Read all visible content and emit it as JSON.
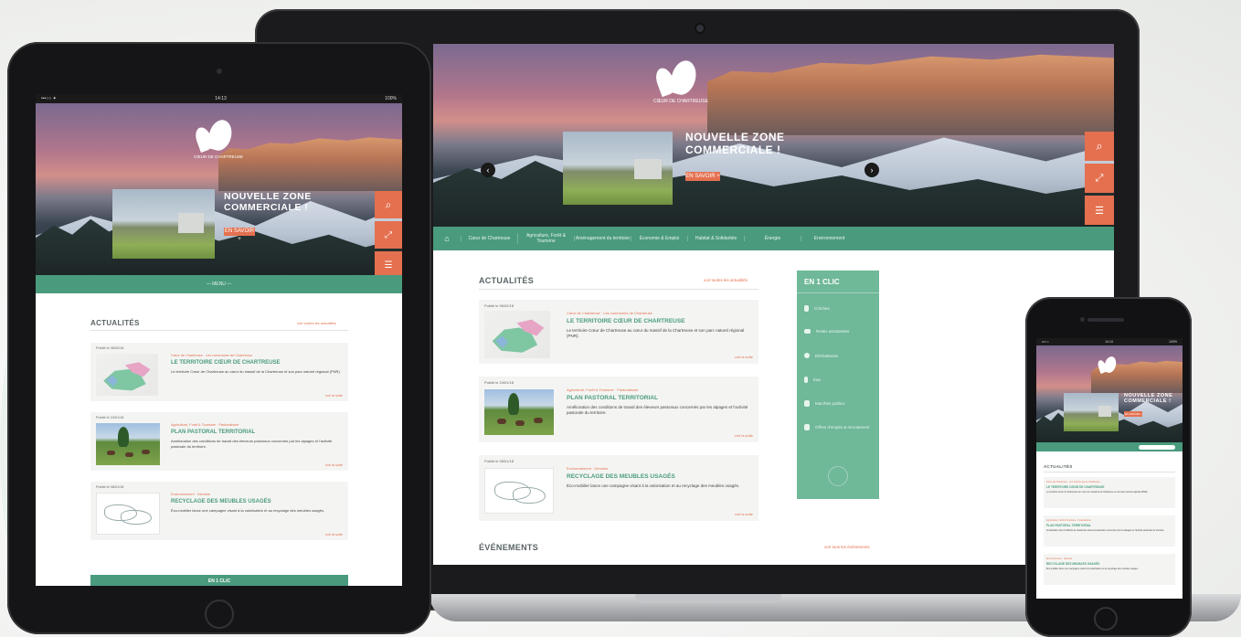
{
  "brand": {
    "logo_text": "CŒUR DE CHARTREUSE",
    "accent": "#4a9b7e",
    "orange": "#e4704f"
  },
  "hero": {
    "title": "NOUVELLE ZONE COMMERCIALE !",
    "button": "EN SAVOIR +"
  },
  "tools": [
    "search-icon",
    "expand-icon",
    "contact-icon"
  ],
  "nav": {
    "items": [
      "Cœur de Chartreuse",
      "Agriculture, Forêt & Tourisme",
      "Aménagement du territoire",
      "Économie & Emploi",
      "Habitat & Solidarités",
      "Énergie",
      "Environnement"
    ],
    "tablet_menu": "— MENU —"
  },
  "news": {
    "title": "ACTUALITÉS",
    "see_all": "voir toutes les actualités",
    "items": [
      {
        "date": "Publié le 06/02/18",
        "tag": "Cœur de Chartreuse · Les communes de Chartreuse",
        "title": "LE TERRITOIRE CŒUR DE CHARTREUSE",
        "text": "Le territoire Cœur de Chartreuse au cœur du massif de la Chartreuse et son parc naturel régional (PNR).",
        "more": "voir la suite"
      },
      {
        "date": "Publié le 24/01/18",
        "tag": "Agriculture, Forêt & Tourisme · Pastoralisme",
        "title": "PLAN PASTORAL TERRITORIAL",
        "text": "Amélioration des conditions de travail des éleveurs pastoraux concernés par les alpages et l'activité pastorale du territoire.",
        "more": "voir la suite"
      },
      {
        "date": "Publié le 08/01/18",
        "tag": "Environnement · Déchets",
        "title": "RECYCLAGE DES MEUBLES USAGÉS",
        "text": "Éco-mobilier lance une campagne visant à la valorisation et au recyclage des meubles usagés.",
        "more": "voir la suite"
      }
    ]
  },
  "events": {
    "title": "ÉVÉNEMENTS",
    "see_all": "voir tous les événements"
  },
  "cdc": {
    "title": "EN 1 CLIC",
    "items": [
      "Crèches",
      "Relais assistantes",
      "Déchetteries",
      "Eau",
      "Marchés publics",
      "Offres d'emploi & recrutement"
    ]
  },
  "status": {
    "left": "•••○○ ✦",
    "time": "14:13",
    "right": "100%"
  },
  "phone_status": {
    "left": "•••○○",
    "time": "14:13",
    "right": "100%"
  }
}
